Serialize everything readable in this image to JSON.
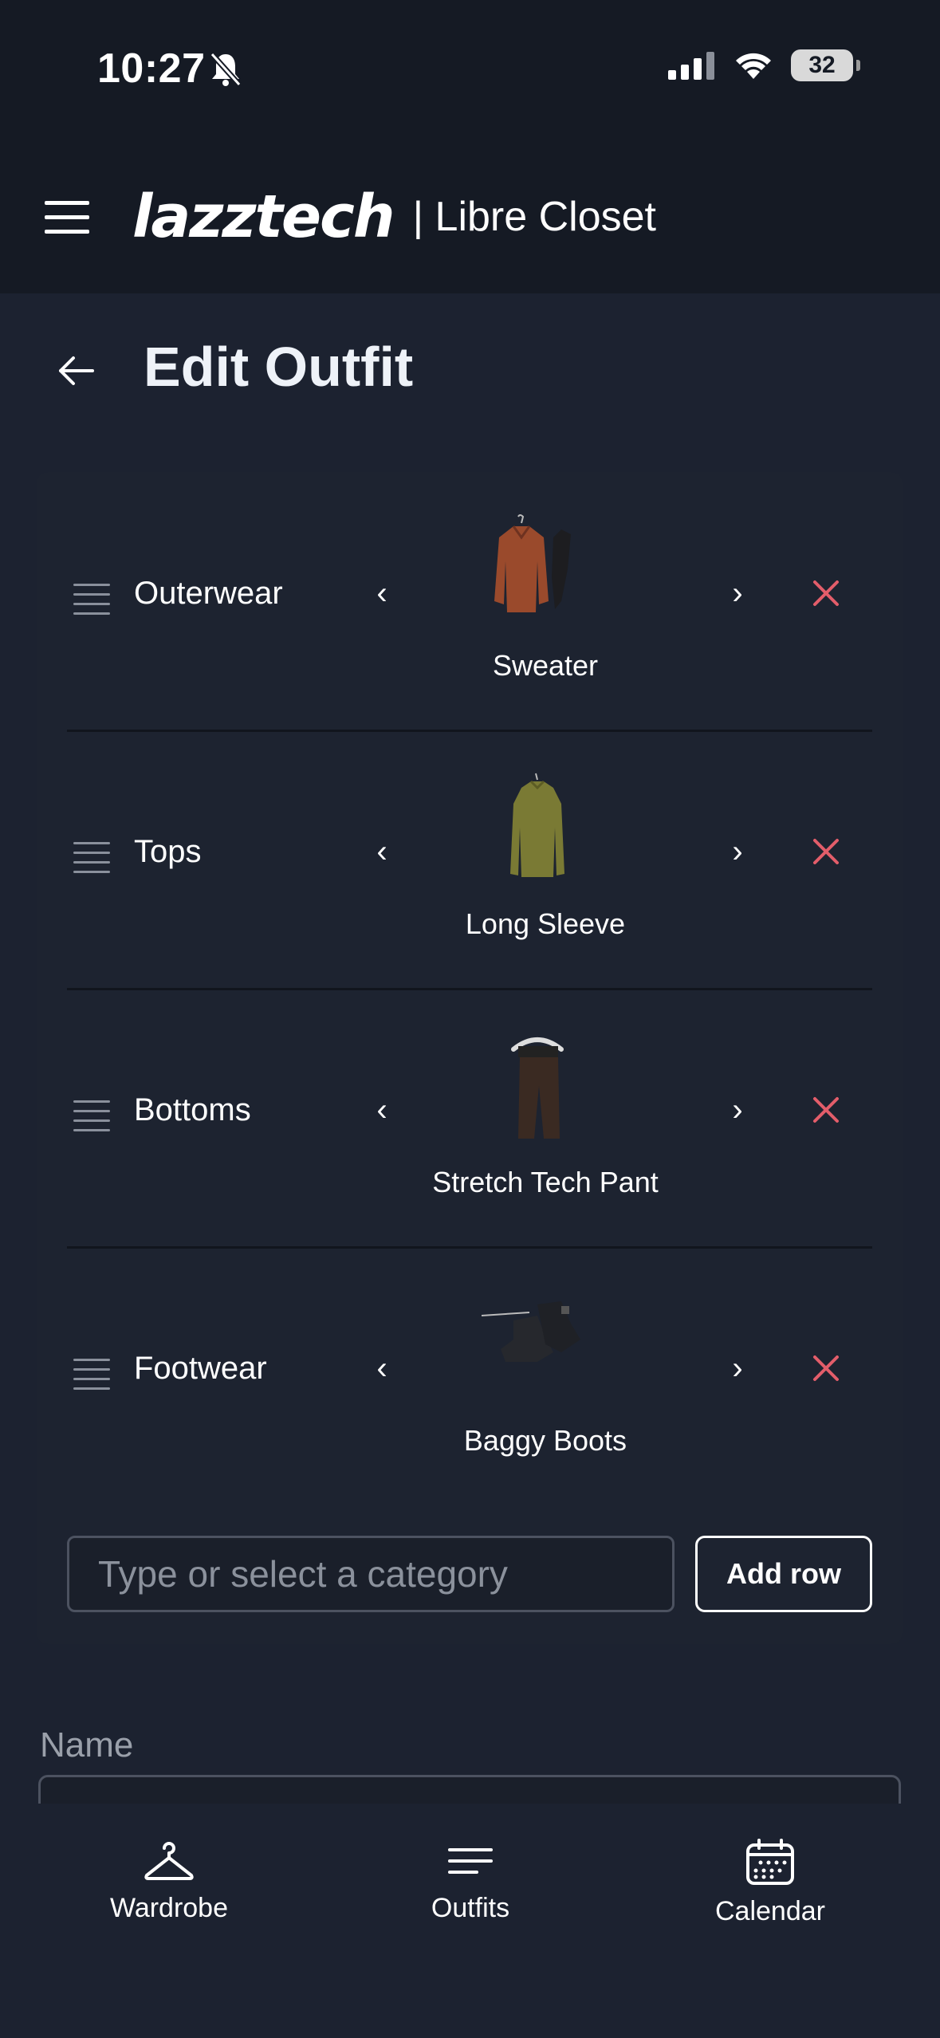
{
  "status_bar": {
    "time": "10:27",
    "battery": "32"
  },
  "header": {
    "brand": "lazztech",
    "tagline": "| Libre Closet"
  },
  "page": {
    "title": "Edit Outfit"
  },
  "rows": [
    {
      "category": "Outerwear",
      "item": "Sweater",
      "color": "#9a4a2c"
    },
    {
      "category": "Tops",
      "item": "Long Sleeve",
      "color": "#7a7a34"
    },
    {
      "category": "Bottoms",
      "item": "Stretch Tech Pant",
      "color": "#3a2a22"
    },
    {
      "category": "Footwear",
      "item": "Baggy Boots",
      "color": "#26282d"
    }
  ],
  "add_row": {
    "placeholder": "Type or select a category",
    "button_label": "Add row"
  },
  "name_field": {
    "label": "Name"
  },
  "bottom_nav": [
    {
      "label": "Wardrobe",
      "icon": "hanger-icon"
    },
    {
      "label": "Outfits",
      "icon": "list-icon"
    },
    {
      "label": "Calendar",
      "icon": "calendar-icon"
    }
  ],
  "colors": {
    "accent_remove": "#e35d6a",
    "background": "#1c2230",
    "header": "#151a24"
  }
}
